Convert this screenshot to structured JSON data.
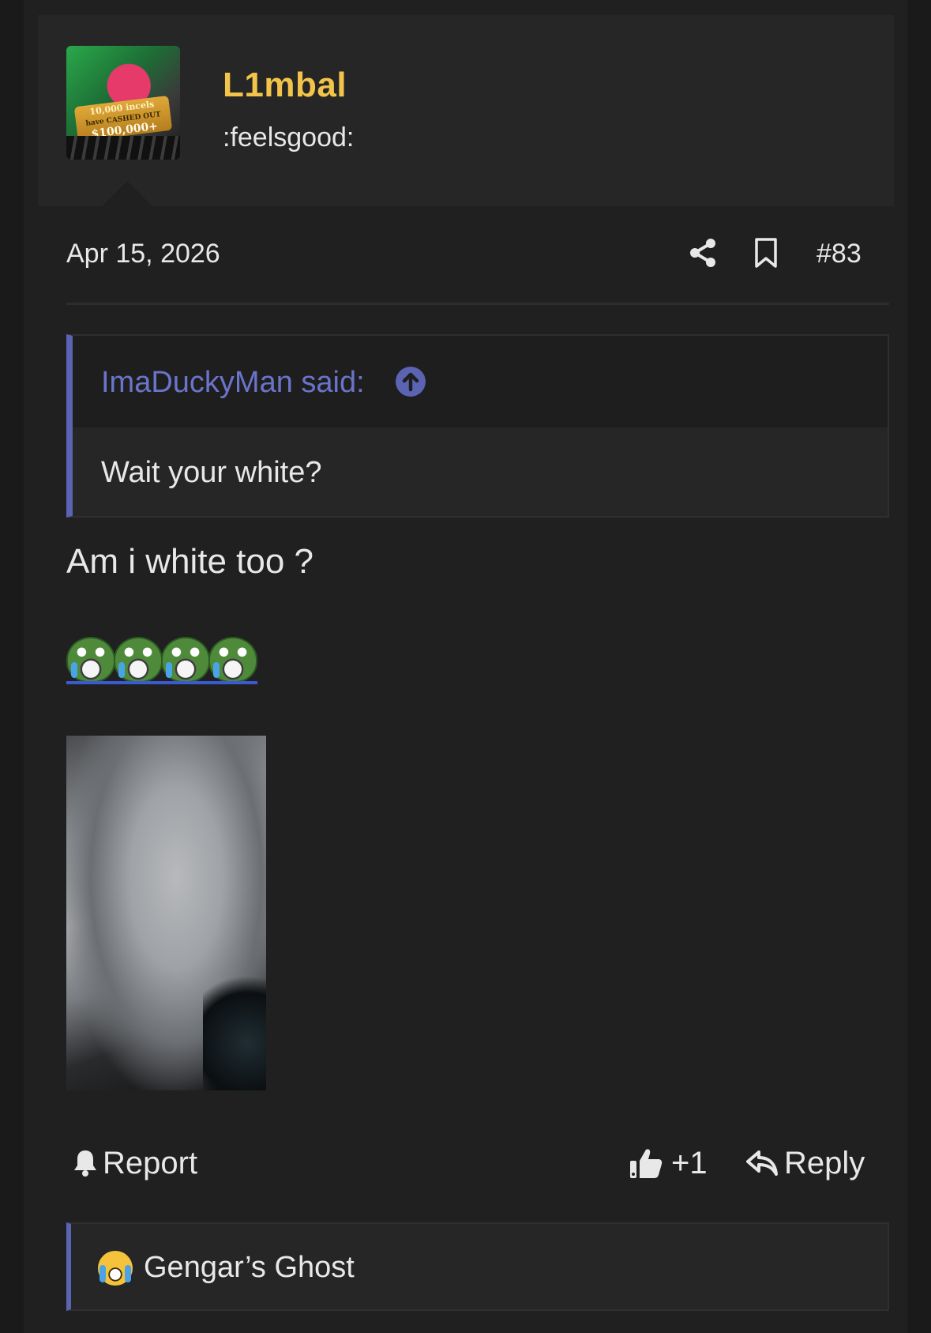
{
  "post": {
    "author": {
      "name": "L1mbal",
      "title": ":feelsgood:",
      "avatar": {
        "line1": "10,000 incels",
        "line2": "have CASHED OUT",
        "line3": "$100,000+"
      }
    },
    "date": "Apr 15, 2026",
    "number": "#83",
    "quote": {
      "author_label": "ImaDuckyMan said:",
      "text": "Wait your white?"
    },
    "body": "Am i white too ?",
    "emoji_count": 4,
    "actions": {
      "report": "Report",
      "like_count": "+1",
      "reply": "Reply"
    },
    "reactions": {
      "names": "Gengar’s Ghost"
    }
  },
  "icons": {
    "share": "share-icon",
    "bookmark": "bookmark-icon",
    "quote_jump": "arrow-up-circle-icon",
    "report": "bell-icon",
    "like": "thumbs-up-icon",
    "reply": "reply-arrow-icon",
    "reaction": "crying-laughing-emoji-icon"
  },
  "colors": {
    "background": "#202020",
    "username": "#f2c54a",
    "accent": "#5b63b3",
    "quote_author": "#6a74c9"
  }
}
